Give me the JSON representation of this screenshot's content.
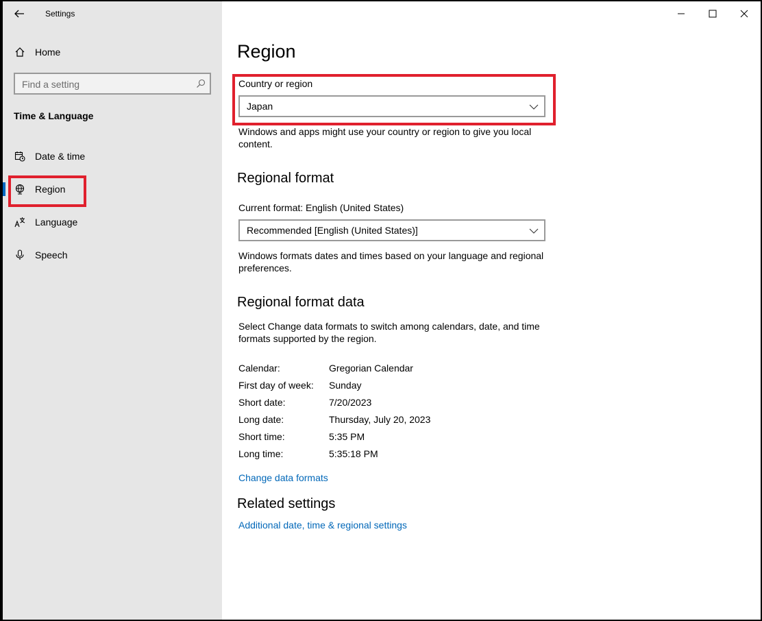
{
  "window": {
    "title": "Settings"
  },
  "titlebar": {
    "minimize_icon": "minimize-icon",
    "maximize_icon": "maximize-icon",
    "close_icon": "close-icon"
  },
  "sidebar": {
    "home_label": "Home",
    "search_placeholder": "Find a setting",
    "section_title": "Time & Language",
    "items": [
      {
        "label": "Date & time",
        "icon": "calendar-clock-icon",
        "selected": false
      },
      {
        "label": "Region",
        "icon": "globe-icon",
        "selected": true
      },
      {
        "label": "Language",
        "icon": "language-icon",
        "selected": false
      },
      {
        "label": "Speech",
        "icon": "microphone-icon",
        "selected": false
      }
    ]
  },
  "main": {
    "title": "Region",
    "country": {
      "label": "Country or region",
      "value": "Japan",
      "description": "Windows and apps might use your country or region to give you local content."
    },
    "regional_format": {
      "heading": "Regional format",
      "current_label": "Current format: English (United States)",
      "value": "Recommended [English (United States)]",
      "description": "Windows formats dates and times based on your language and regional preferences."
    },
    "format_data": {
      "heading": "Regional format data",
      "description": "Select Change data formats to switch among calendars, date, and time formats supported by the region.",
      "rows": [
        {
          "label": "Calendar:",
          "value": "Gregorian Calendar"
        },
        {
          "label": "First day of week:",
          "value": "Sunday"
        },
        {
          "label": "Short date:",
          "value": "7/20/2023"
        },
        {
          "label": "Long date:",
          "value": "Thursday, July 20, 2023"
        },
        {
          "label": "Short time:",
          "value": "5:35 PM"
        },
        {
          "label": "Long time:",
          "value": "5:35:18 PM"
        }
      ],
      "change_link": "Change data formats"
    },
    "related": {
      "heading": "Related settings",
      "link": "Additional date, time & regional settings"
    }
  },
  "colors": {
    "accent": "#0067c0",
    "link": "#0067b8",
    "highlight": "#e0202d",
    "sidebar_bg": "#e6e6e6"
  }
}
